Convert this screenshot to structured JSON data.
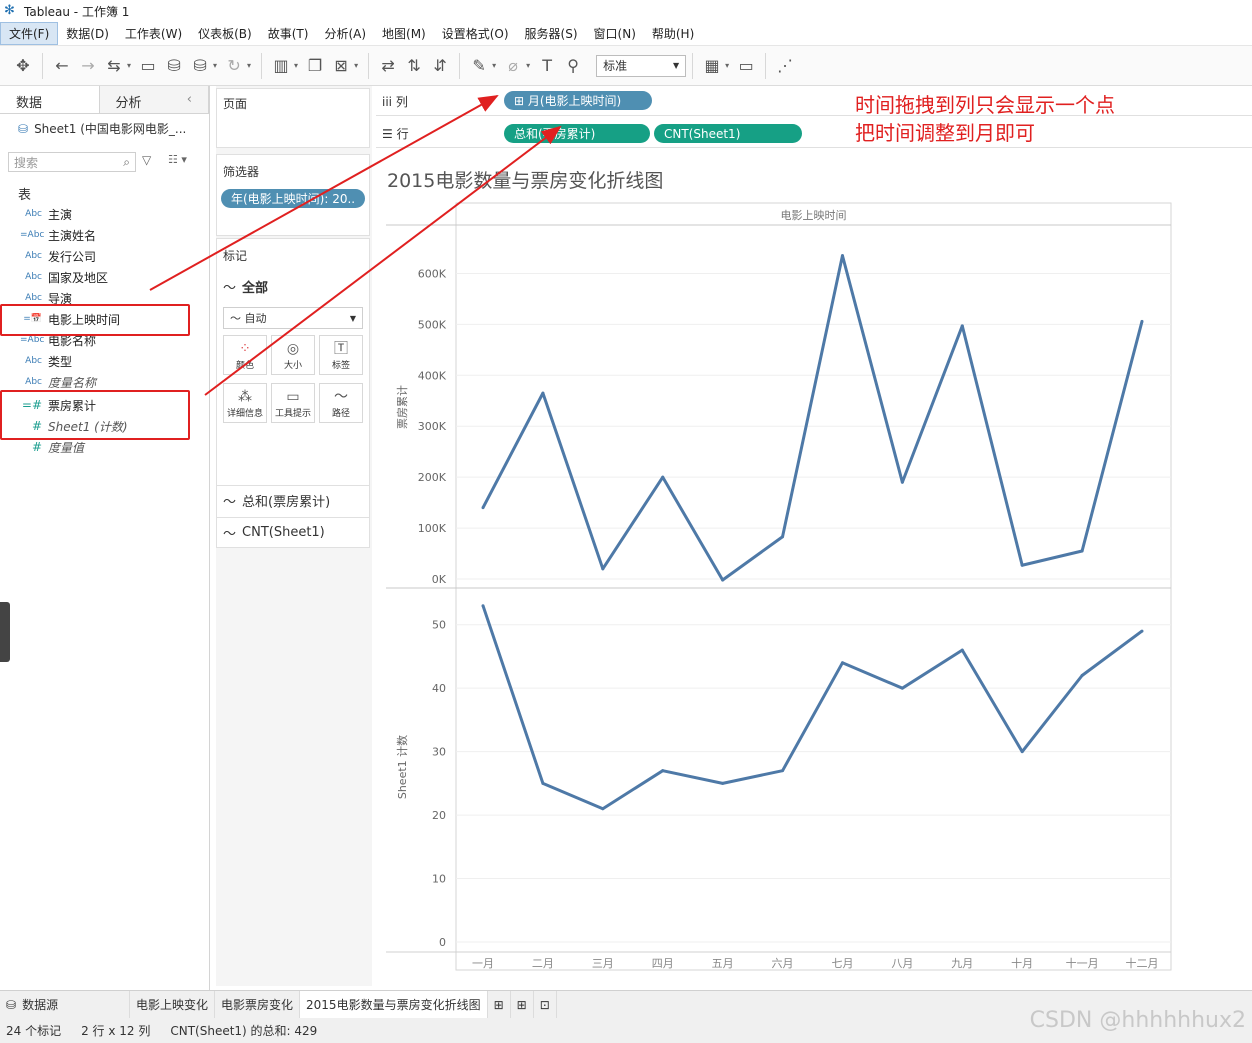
{
  "window": {
    "title": "Tableau - 工作簿 1"
  },
  "menu": [
    "文件(F)",
    "数据(D)",
    "工作表(W)",
    "仪表板(B)",
    "故事(T)",
    "分析(A)",
    "地图(M)",
    "设置格式(O)",
    "服务器(S)",
    "窗口(N)",
    "帮助(H)"
  ],
  "toolbar": {
    "fit_select": "标准"
  },
  "left_pane": {
    "tab_data": "数据",
    "tab_analysis": "分析",
    "datasource": "Sheet1 (中国电影网电影_...",
    "search_placeholder": "搜索",
    "section_table": "表",
    "fields": [
      {
        "type": "Abc",
        "name": "主演"
      },
      {
        "type": "=Abc",
        "name": "主演姓名"
      },
      {
        "type": "Abc",
        "name": "发行公司"
      },
      {
        "type": "Abc",
        "name": "国家及地区"
      },
      {
        "type": "Abc",
        "name": "导演"
      },
      {
        "type": "=📅",
        "name": "电影上映时间"
      },
      {
        "type": "=Abc",
        "name": "电影名称"
      },
      {
        "type": "Abc",
        "name": "类型"
      },
      {
        "type": "Abc",
        "name": "度量名称"
      },
      {
        "type": "=#",
        "name": "票房累计"
      },
      {
        "type": "#",
        "name": "Sheet1 (计数)"
      },
      {
        "type": "#",
        "name": "度量值"
      }
    ]
  },
  "cards": {
    "pages": "页面",
    "filters": "筛选器",
    "filter_pill": "年(电影上映时间): 20..",
    "marks": "标记",
    "marks_all": "全部",
    "marks_type": "自动",
    "mark_buttons": [
      "颜色",
      "大小",
      "标签",
      "详细信息",
      "工具提示",
      "路径"
    ],
    "measure1": "总和(票房累计)",
    "measure2": "CNT(Sheet1)"
  },
  "shelves": {
    "columns_label": "列",
    "rows_label": "行",
    "columns_pill": "⊞ 月(电影上映时间)",
    "rows_pill1": "总和(票房累计)",
    "rows_pill2": "CNT(Sheet1)"
  },
  "annotation": {
    "line1": "时间拖拽到列只会显示一个点",
    "line2": "把时间调整到月即可"
  },
  "chart_data": [
    {
      "type": "line",
      "title": "2015电影数量与票房变化折线图",
      "xlabel": "电影上映时间",
      "ylabel": "票房累计",
      "categories": [
        "一月",
        "二月",
        "三月",
        "四月",
        "五月",
        "六月",
        "七月",
        "八月",
        "九月",
        "十月",
        "十一月",
        "十二月"
      ],
      "values": [
        140000,
        365000,
        20000,
        200000,
        -2000,
        83000,
        635000,
        190000,
        497000,
        27000,
        55000,
        506000
      ],
      "ylim": [
        0,
        650000
      ],
      "yticks": [
        0,
        100000,
        200000,
        300000,
        400000,
        500000,
        600000
      ],
      "ytick_labels": [
        "0K",
        "100K",
        "200K",
        "300K",
        "400K",
        "500K",
        "600K"
      ],
      "color": "#4e79a7"
    },
    {
      "type": "line",
      "ylabel": "Sheet1 计数",
      "categories": [
        "一月",
        "二月",
        "三月",
        "四月",
        "五月",
        "六月",
        "七月",
        "八月",
        "九月",
        "十月",
        "十一月",
        "十二月"
      ],
      "values": [
        53,
        25,
        21,
        27,
        25,
        27,
        44,
        40,
        46,
        30,
        42,
        49
      ],
      "ylim": [
        0,
        55
      ],
      "yticks": [
        0,
        10,
        20,
        30,
        40,
        50
      ],
      "ytick_labels": [
        "0",
        "10",
        "20",
        "30",
        "40",
        "50"
      ],
      "color": "#4e79a7"
    }
  ],
  "bottom_tabs": [
    "数据源",
    "电影上映变化",
    "电影票房变化",
    "2015电影数量与票房变化折线图"
  ],
  "status": {
    "marks": "24 个标记",
    "dims": "2 行 x 12 列",
    "sum": "CNT(Sheet1) 的总和: 429"
  },
  "watermark": "CSDN @hhhhhhux2"
}
